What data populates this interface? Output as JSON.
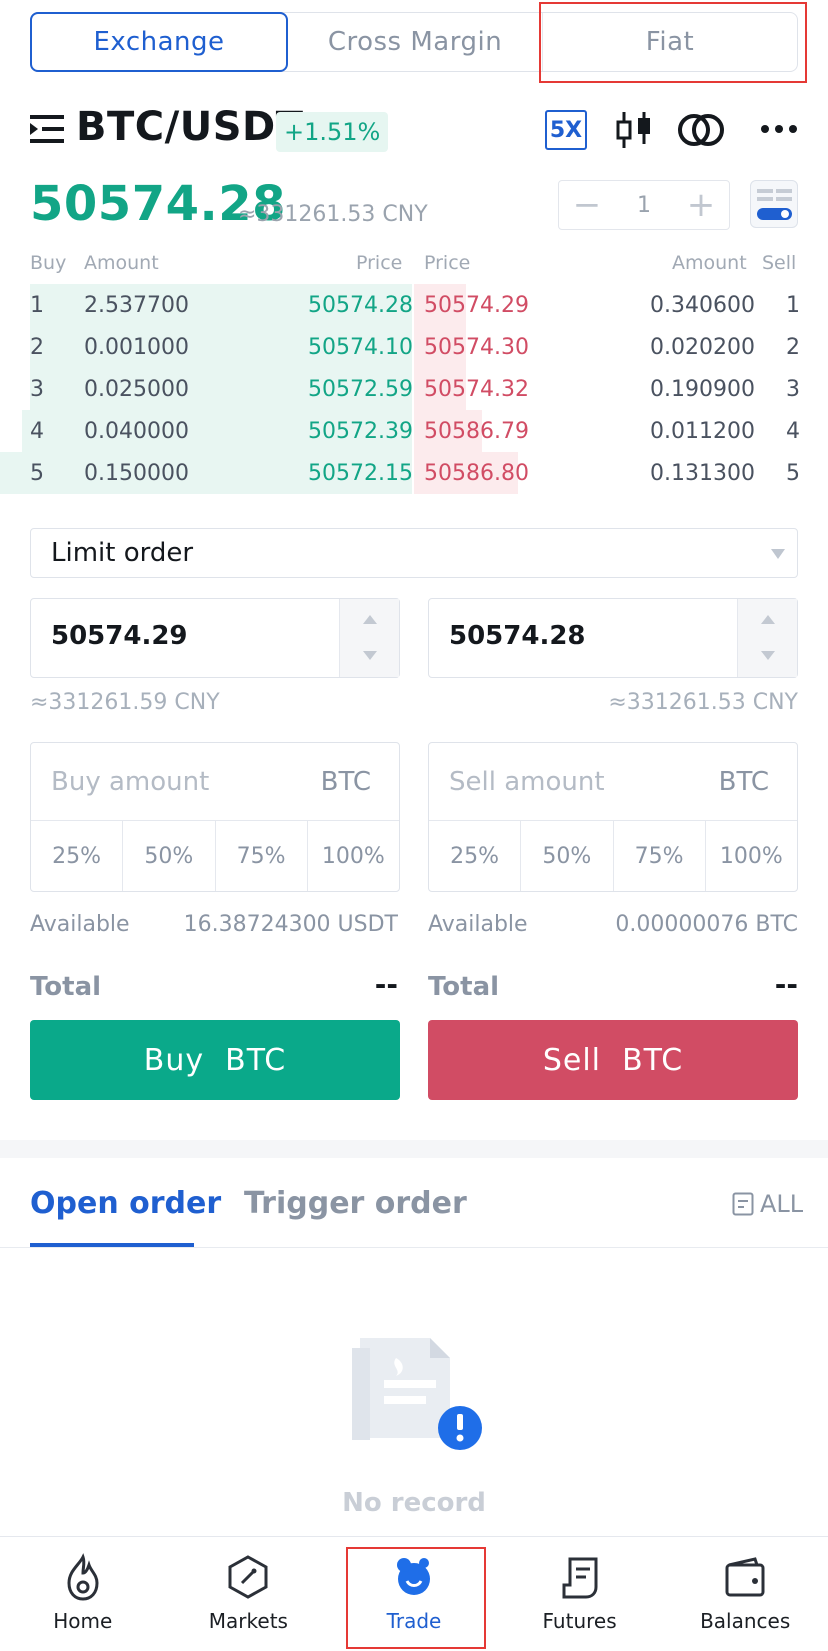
{
  "tabs": [
    {
      "label": "Exchange",
      "active": true
    },
    {
      "label": "Cross Margin",
      "active": false
    },
    {
      "label": "Fiat",
      "active": false
    }
  ],
  "header": {
    "pair": "BTC/USDT",
    "change": "+1.51%",
    "leverage": "5X",
    "icons": [
      "menu-icon",
      "candlestick-icon",
      "ratio-icon",
      "more-icon"
    ]
  },
  "price": {
    "last": "50574.28",
    "cny": "≈331261.53 CNY",
    "stepper_value": "1"
  },
  "orderbook": {
    "headers": {
      "buy": "Buy",
      "amount_left": "Amount",
      "price_left": "Price",
      "price_right": "Price",
      "amount_right": "Amount",
      "sell": "Sell"
    },
    "rows": [
      {
        "idx": "1",
        "buy_amount": "2.537700",
        "buy_price": "50574.28",
        "sell_price": "50574.29",
        "sell_amount": "0.340600",
        "sidx": "1"
      },
      {
        "idx": "2",
        "buy_amount": "0.001000",
        "buy_price": "50574.10",
        "sell_price": "50574.30",
        "sell_amount": "0.020200",
        "sidx": "2"
      },
      {
        "idx": "3",
        "buy_amount": "0.025000",
        "buy_price": "50572.59",
        "sell_price": "50574.32",
        "sell_amount": "0.190900",
        "sidx": "3"
      },
      {
        "idx": "4",
        "buy_amount": "0.040000",
        "buy_price": "50572.39",
        "sell_price": "50586.79",
        "sell_amount": "0.011200",
        "sidx": "4"
      },
      {
        "idx": "5",
        "buy_amount": "0.150000",
        "buy_price": "50572.15",
        "sell_price": "50586.80",
        "sell_amount": "0.131300",
        "sidx": "5"
      }
    ]
  },
  "order_form": {
    "order_type": "Limit order",
    "buy_price": "50574.29",
    "sell_price": "50574.28",
    "buy_cny": "≈331261.59 CNY",
    "sell_cny": "≈331261.53 CNY",
    "buy_amount_placeholder": "Buy amount",
    "sell_amount_placeholder": "Sell amount",
    "buy_unit": "BTC",
    "sell_unit": "BTC",
    "percentages": [
      "25%",
      "50%",
      "75%",
      "100%"
    ],
    "available_label": "Available",
    "buy_available": "16.38724300 USDT",
    "sell_available": "0.00000076 BTC",
    "total_label": "Total",
    "buy_total": "--",
    "sell_total": "--",
    "buy_button": "Buy  BTC",
    "sell_button": "Sell  BTC"
  },
  "orders": {
    "tab_open": "Open order",
    "tab_trigger": "Trigger order",
    "all_link": "ALL",
    "empty_text": "No record"
  },
  "nav": [
    {
      "label": "Home",
      "icon": "flame-icon"
    },
    {
      "label": "Markets",
      "icon": "compass-icon"
    },
    {
      "label": "Trade",
      "icon": "trade-icon",
      "active": true
    },
    {
      "label": "Futures",
      "icon": "document-icon"
    },
    {
      "label": "Balances",
      "icon": "wallet-icon"
    }
  ],
  "colors": {
    "primary": "#1f5fd0",
    "buy": "#0aa98a",
    "sell": "#d14c64",
    "highlight": "#e53935"
  }
}
